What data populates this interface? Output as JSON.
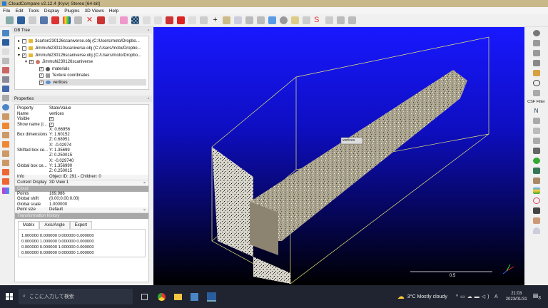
{
  "window": {
    "title": "CloudCompare v2.12.4 (Kyiv) Stereo [64-bit]"
  },
  "menu": [
    "File",
    "Edit",
    "Tools",
    "Display",
    "Plugins",
    "3D Views",
    "Help"
  ],
  "db_tree": {
    "title": "DB Tree",
    "items": [
      {
        "label": "3carton230126scaniverse.obj (C:/Users/moto/Dropbo...",
        "checked": false,
        "expanded": false
      },
      {
        "label": "Jimmuhi230110scaniverse.obj (C:/Users/moto/Dropbo...",
        "checked": false,
        "expanded": false
      },
      {
        "label": "Jimmuhi230126scaniverse.obj (C:/Users/moto/Dropbo...",
        "checked": true,
        "expanded": true
      },
      {
        "label": "Jimmuhi230126scaniverse",
        "checked": true
      },
      {
        "label": "materials",
        "checked": true
      },
      {
        "label": "Texture coordinates",
        "checked": true
      },
      {
        "label": "vertices",
        "checked": true,
        "selected": true
      }
    ]
  },
  "properties": {
    "title": "Properties",
    "header": [
      "Property",
      "State/Value"
    ],
    "name": "vertices",
    "visible_label": "Visible",
    "name_label": "Name",
    "show_name_label": "Show name (i...",
    "box_dimensions": {
      "label": "Box dimensions",
      "x": "X: 0.66956",
      "y": "Y: 1.60152",
      "z": "Z: 0.68951"
    },
    "shifted_center": {
      "label": "Shifted box ce...",
      "x": "X: -0.02974",
      "y": "Y: 1.35699",
      "z": "Z: 0.250015"
    },
    "global_center": {
      "label": "Global box ce...",
      "x": "X: -0.029740",
      "y": "Y: 1.356990",
      "z": "Z: 0.250015"
    },
    "info": {
      "label": "Info",
      "value": "Object ID: 291 - Children: 0"
    },
    "current_display": {
      "label": "Current Display",
      "value": "3D View 1"
    },
    "cloud_section": "Cloud",
    "points": {
      "label": "Points",
      "value": "169,986"
    },
    "global_shift": {
      "label": "Global shift",
      "value": "(0.00;0.00;0.00)"
    },
    "global_scale": {
      "label": "Global scale",
      "value": "1.000000"
    },
    "point_size": {
      "label": "Point size",
      "value": "Default"
    },
    "transform_section": "Transformation history",
    "tabs": [
      "Matrix",
      "Axis/Angle",
      "Export"
    ],
    "matrix": [
      "1.000000 0.000000 0.000000 0.000000",
      "0.000000 1.000000 0.000000 0.000000",
      "0.000000 0.000000 1.000000 0.000000",
      "0.000000 0.000000 0.000000 1.000000"
    ]
  },
  "view": {
    "label": "vertices",
    "scale_label": "0.5"
  },
  "right_tools": {
    "csf_label": "CSF Filter"
  },
  "taskbar": {
    "search_placeholder": "ここに入力して検索",
    "weather": "3°C  Mostly cloudy",
    "time": "21:03",
    "date": "2023/01/31",
    "notif_count": "3"
  }
}
